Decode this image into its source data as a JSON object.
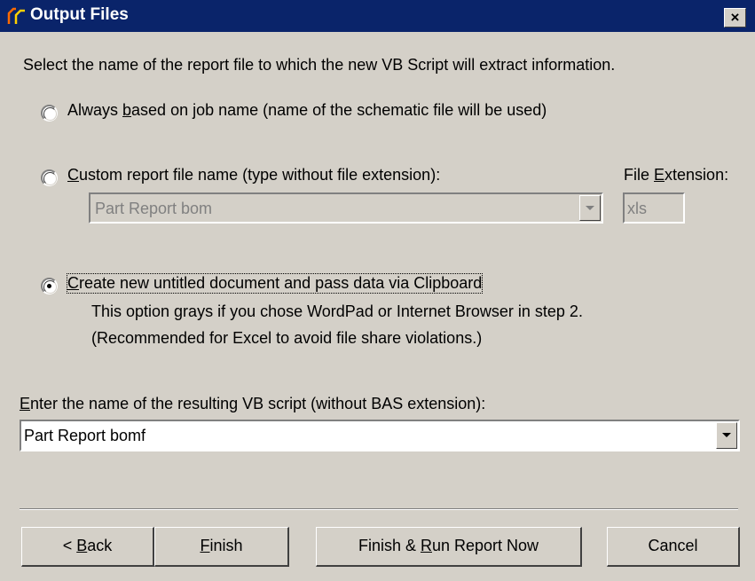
{
  "window": {
    "title": "Output Files",
    "close_label": "×"
  },
  "instructions": "Select the name of the report file to which the new VB Script will extract information.",
  "options": {
    "job_name": {
      "pre": "Always ",
      "accel": "b",
      "post": "ased on job name (name of the schematic file will be used)",
      "selected": false
    },
    "custom": {
      "pre": "",
      "accel": "C",
      "post": "ustom report file name (type without file extension):",
      "selected": false,
      "file_value": "Part Report bom",
      "ext_label_pre": "File ",
      "ext_label_accel": "E",
      "ext_label_post": "xtension:",
      "ext_value": "xls"
    },
    "clipboard": {
      "pre": "",
      "accel": "C",
      "post": "reate new untitled document and pass data via Clipboard",
      "selected": true,
      "note1": "This option grays if you chose WordPad or Internet Browser in step 2.",
      "note2": "(Recommended for Excel to avoid file share violations.)"
    }
  },
  "script_name": {
    "label_accel": "E",
    "label_post": "nter the name of the resulting VB script (without BAS extension):",
    "value": "Part Report bomf"
  },
  "buttons": {
    "back": {
      "pre": "< ",
      "accel": "B",
      "post": "ack"
    },
    "finish": {
      "pre": "",
      "accel": "F",
      "post": "inish"
    },
    "finish_run": {
      "pre": "Finish & ",
      "accel": "R",
      "post": "un Report Now"
    },
    "cancel": {
      "label": "Cancel"
    }
  },
  "colors": {
    "title_bar": "#0a246a",
    "face": "#d4d0c8",
    "disabled_text": "#808080"
  }
}
